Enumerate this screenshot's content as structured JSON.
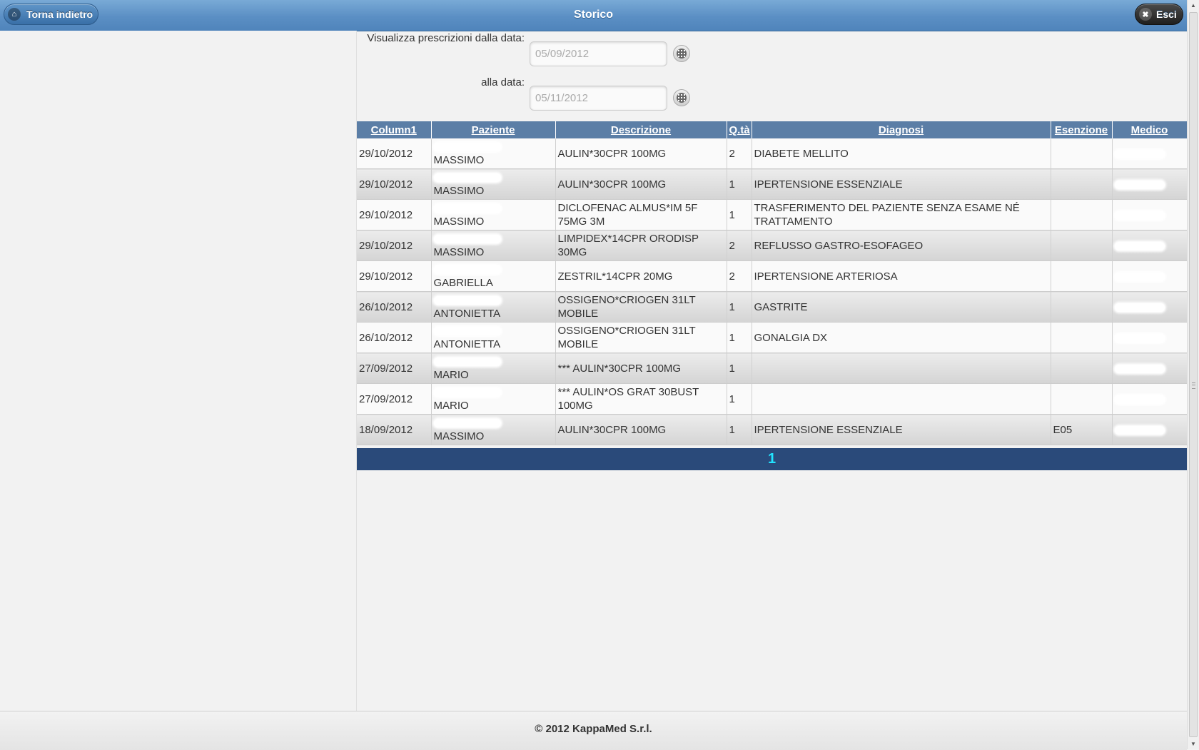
{
  "header": {
    "title": "Storico",
    "back_label": "Torna indietro",
    "exit_label": "Esci"
  },
  "filters": {
    "from_label": "Visualizza prescrizioni dalla data:",
    "from_value": "05/09/2012",
    "to_label": "alla data:",
    "to_value": "05/11/2012"
  },
  "table": {
    "columns": [
      "Column1",
      "Paziente",
      "Descrizione",
      "Q.tà",
      "Diagnosi",
      "Esenzione",
      "Medico"
    ],
    "rows": [
      {
        "date": "29/10/2012",
        "patient": "MASSIMO",
        "desc": "AULIN*30CPR 100MG",
        "qty": "2",
        "diag": "DIABETE MELLITO",
        "exempt": ""
      },
      {
        "date": "29/10/2012",
        "patient": "MASSIMO",
        "desc": "AULIN*30CPR 100MG",
        "qty": "1",
        "diag": "IPERTENSIONE ESSENZIALE",
        "exempt": ""
      },
      {
        "date": "29/10/2012",
        "patient": "MASSIMO",
        "desc": "DICLOFENAC ALMUS*IM 5F 75MG 3M",
        "qty": "1",
        "diag": "TRASFERIMENTO DEL PAZIENTE SENZA ESAME NÉ TRATTAMENTO",
        "exempt": ""
      },
      {
        "date": "29/10/2012",
        "patient": "MASSIMO",
        "desc": "LIMPIDEX*14CPR ORODISP 30MG",
        "qty": "2",
        "diag": "REFLUSSO GASTRO-ESOFAGEO",
        "exempt": ""
      },
      {
        "date": "29/10/2012",
        "patient": "GABRIELLA",
        "desc": "ZESTRIL*14CPR 20MG",
        "qty": "2",
        "diag": "IPERTENSIONE ARTERIOSA",
        "exempt": ""
      },
      {
        "date": "26/10/2012",
        "patient": "ANTONIETTA",
        "desc": "OSSIGENO*CRIOGEN 31LT MOBILE",
        "qty": "1",
        "diag": "GASTRITE",
        "exempt": ""
      },
      {
        "date": "26/10/2012",
        "patient": "ANTONIETTA",
        "desc": "OSSIGENO*CRIOGEN 31LT MOBILE",
        "qty": "1",
        "diag": "GONALGIA DX",
        "exempt": ""
      },
      {
        "date": "27/09/2012",
        "patient": "MARIO",
        "desc": "*** AULIN*30CPR 100MG",
        "qty": "1",
        "diag": "",
        "exempt": ""
      },
      {
        "date": "27/09/2012",
        "patient": "MARIO",
        "desc": "*** AULIN*OS GRAT 30BUST 100MG",
        "qty": "1",
        "diag": "",
        "exempt": ""
      },
      {
        "date": "18/09/2012",
        "patient": "MASSIMO",
        "desc": "AULIN*30CPR 100MG",
        "qty": "1",
        "diag": "IPERTENSIONE ESSENZIALE",
        "exempt": "E05"
      }
    ]
  },
  "pager": {
    "current": "1"
  },
  "footer": {
    "copyright": "© 2012 KappaMed S.r.l."
  },
  "icons": {
    "back": "home-icon",
    "exit": "close-icon",
    "calendar": "calendar-icon"
  },
  "colors": {
    "header": "#5b8fc4",
    "table_header": "#5b7ea6",
    "pager": "#2a4a7a",
    "pager_text": "#22e4ff"
  }
}
